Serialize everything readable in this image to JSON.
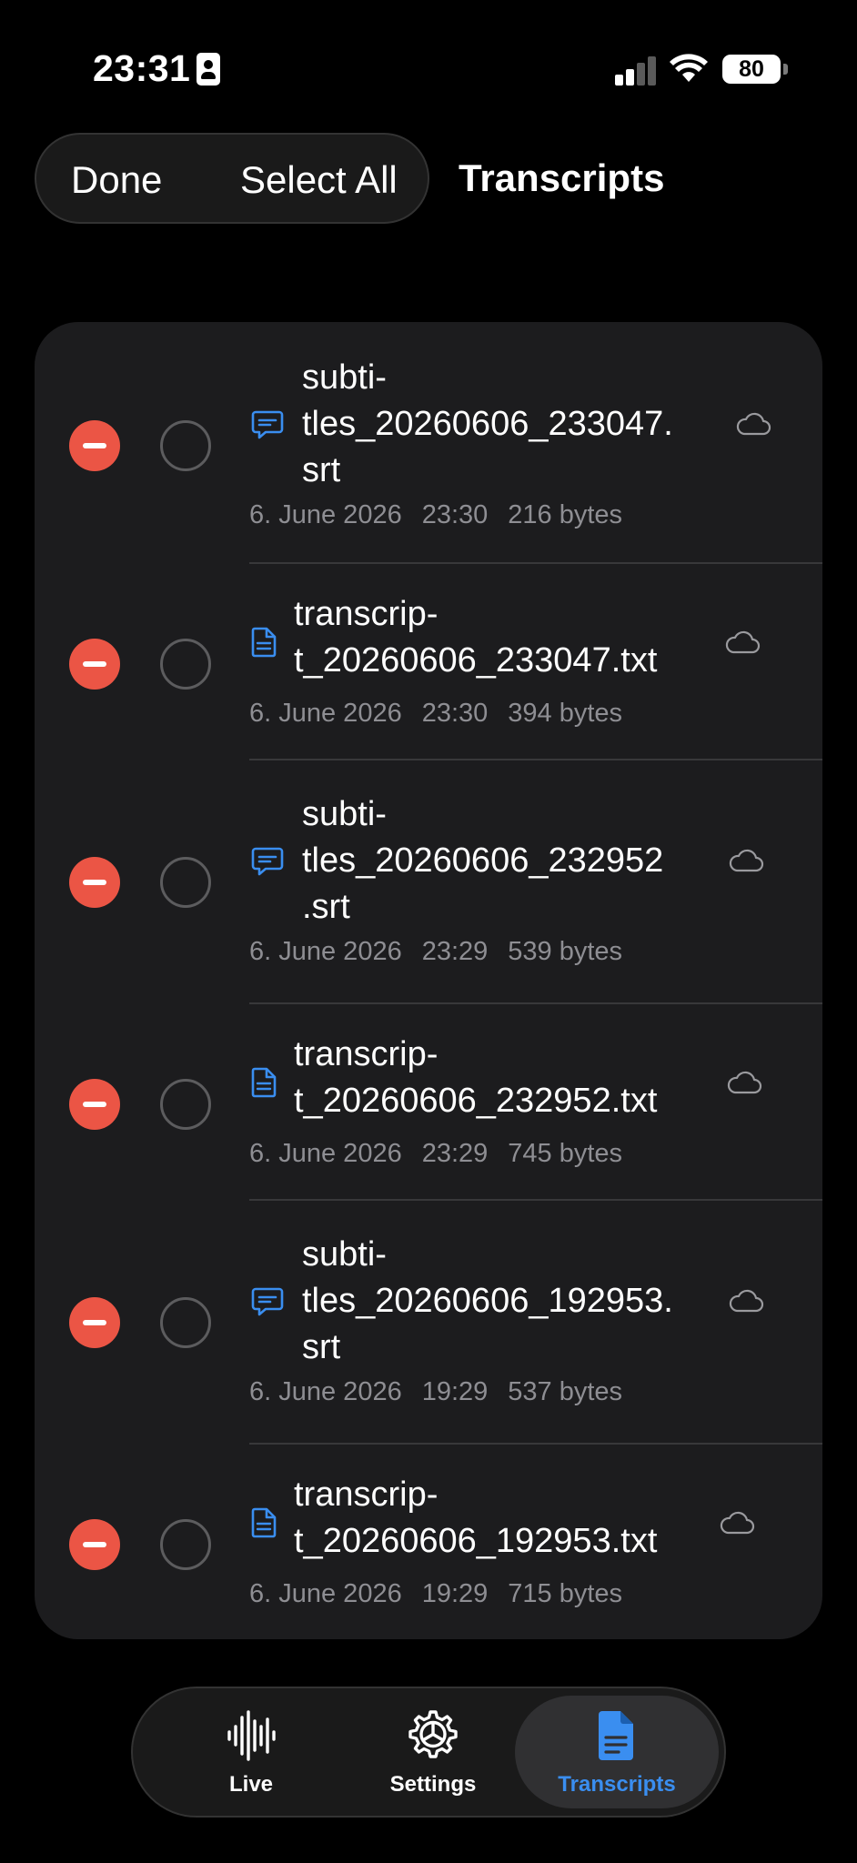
{
  "status_bar": {
    "time": "23:31",
    "battery": "80"
  },
  "nav": {
    "done_label": "Done",
    "select_all_label": "Select All",
    "title": "Transcripts"
  },
  "files": [
    {
      "name": "subti-\ntles_20260606_233047.\nsrt",
      "type": "subtitles",
      "date": "6. June 2026",
      "time": "23:30",
      "size": "216 bytes"
    },
    {
      "name": "transcrip-\nt_20260606_233047.txt",
      "type": "transcript",
      "date": "6. June 2026",
      "time": "23:30",
      "size": "394 bytes"
    },
    {
      "name": "subti-\ntles_20260606_232952\n.srt",
      "type": "subtitles",
      "date": "6. June 2026",
      "time": "23:29",
      "size": "539 bytes"
    },
    {
      "name": "transcrip-\nt_20260606_232952.txt",
      "type": "transcript",
      "date": "6. June 2026",
      "time": "23:29",
      "size": "745 bytes"
    },
    {
      "name": "subti-\ntles_20260606_192953.\nsrt",
      "type": "subtitles",
      "date": "6. June 2026",
      "time": "19:29",
      "size": "537 bytes"
    },
    {
      "name": "transcrip-\nt_20260606_192953.txt",
      "type": "transcript",
      "date": "6. June 2026",
      "time": "19:29",
      "size": "715 bytes"
    }
  ],
  "tabs": [
    {
      "label": "Live",
      "icon": "waveform-icon"
    },
    {
      "label": "Settings",
      "icon": "gear-icon"
    },
    {
      "label": "Transcripts",
      "icon": "document-icon",
      "active": true
    }
  ],
  "colors": {
    "accent": "#3a8ef0",
    "delete": "#eb5545",
    "background": "#000000",
    "card": "#1c1c1e"
  }
}
